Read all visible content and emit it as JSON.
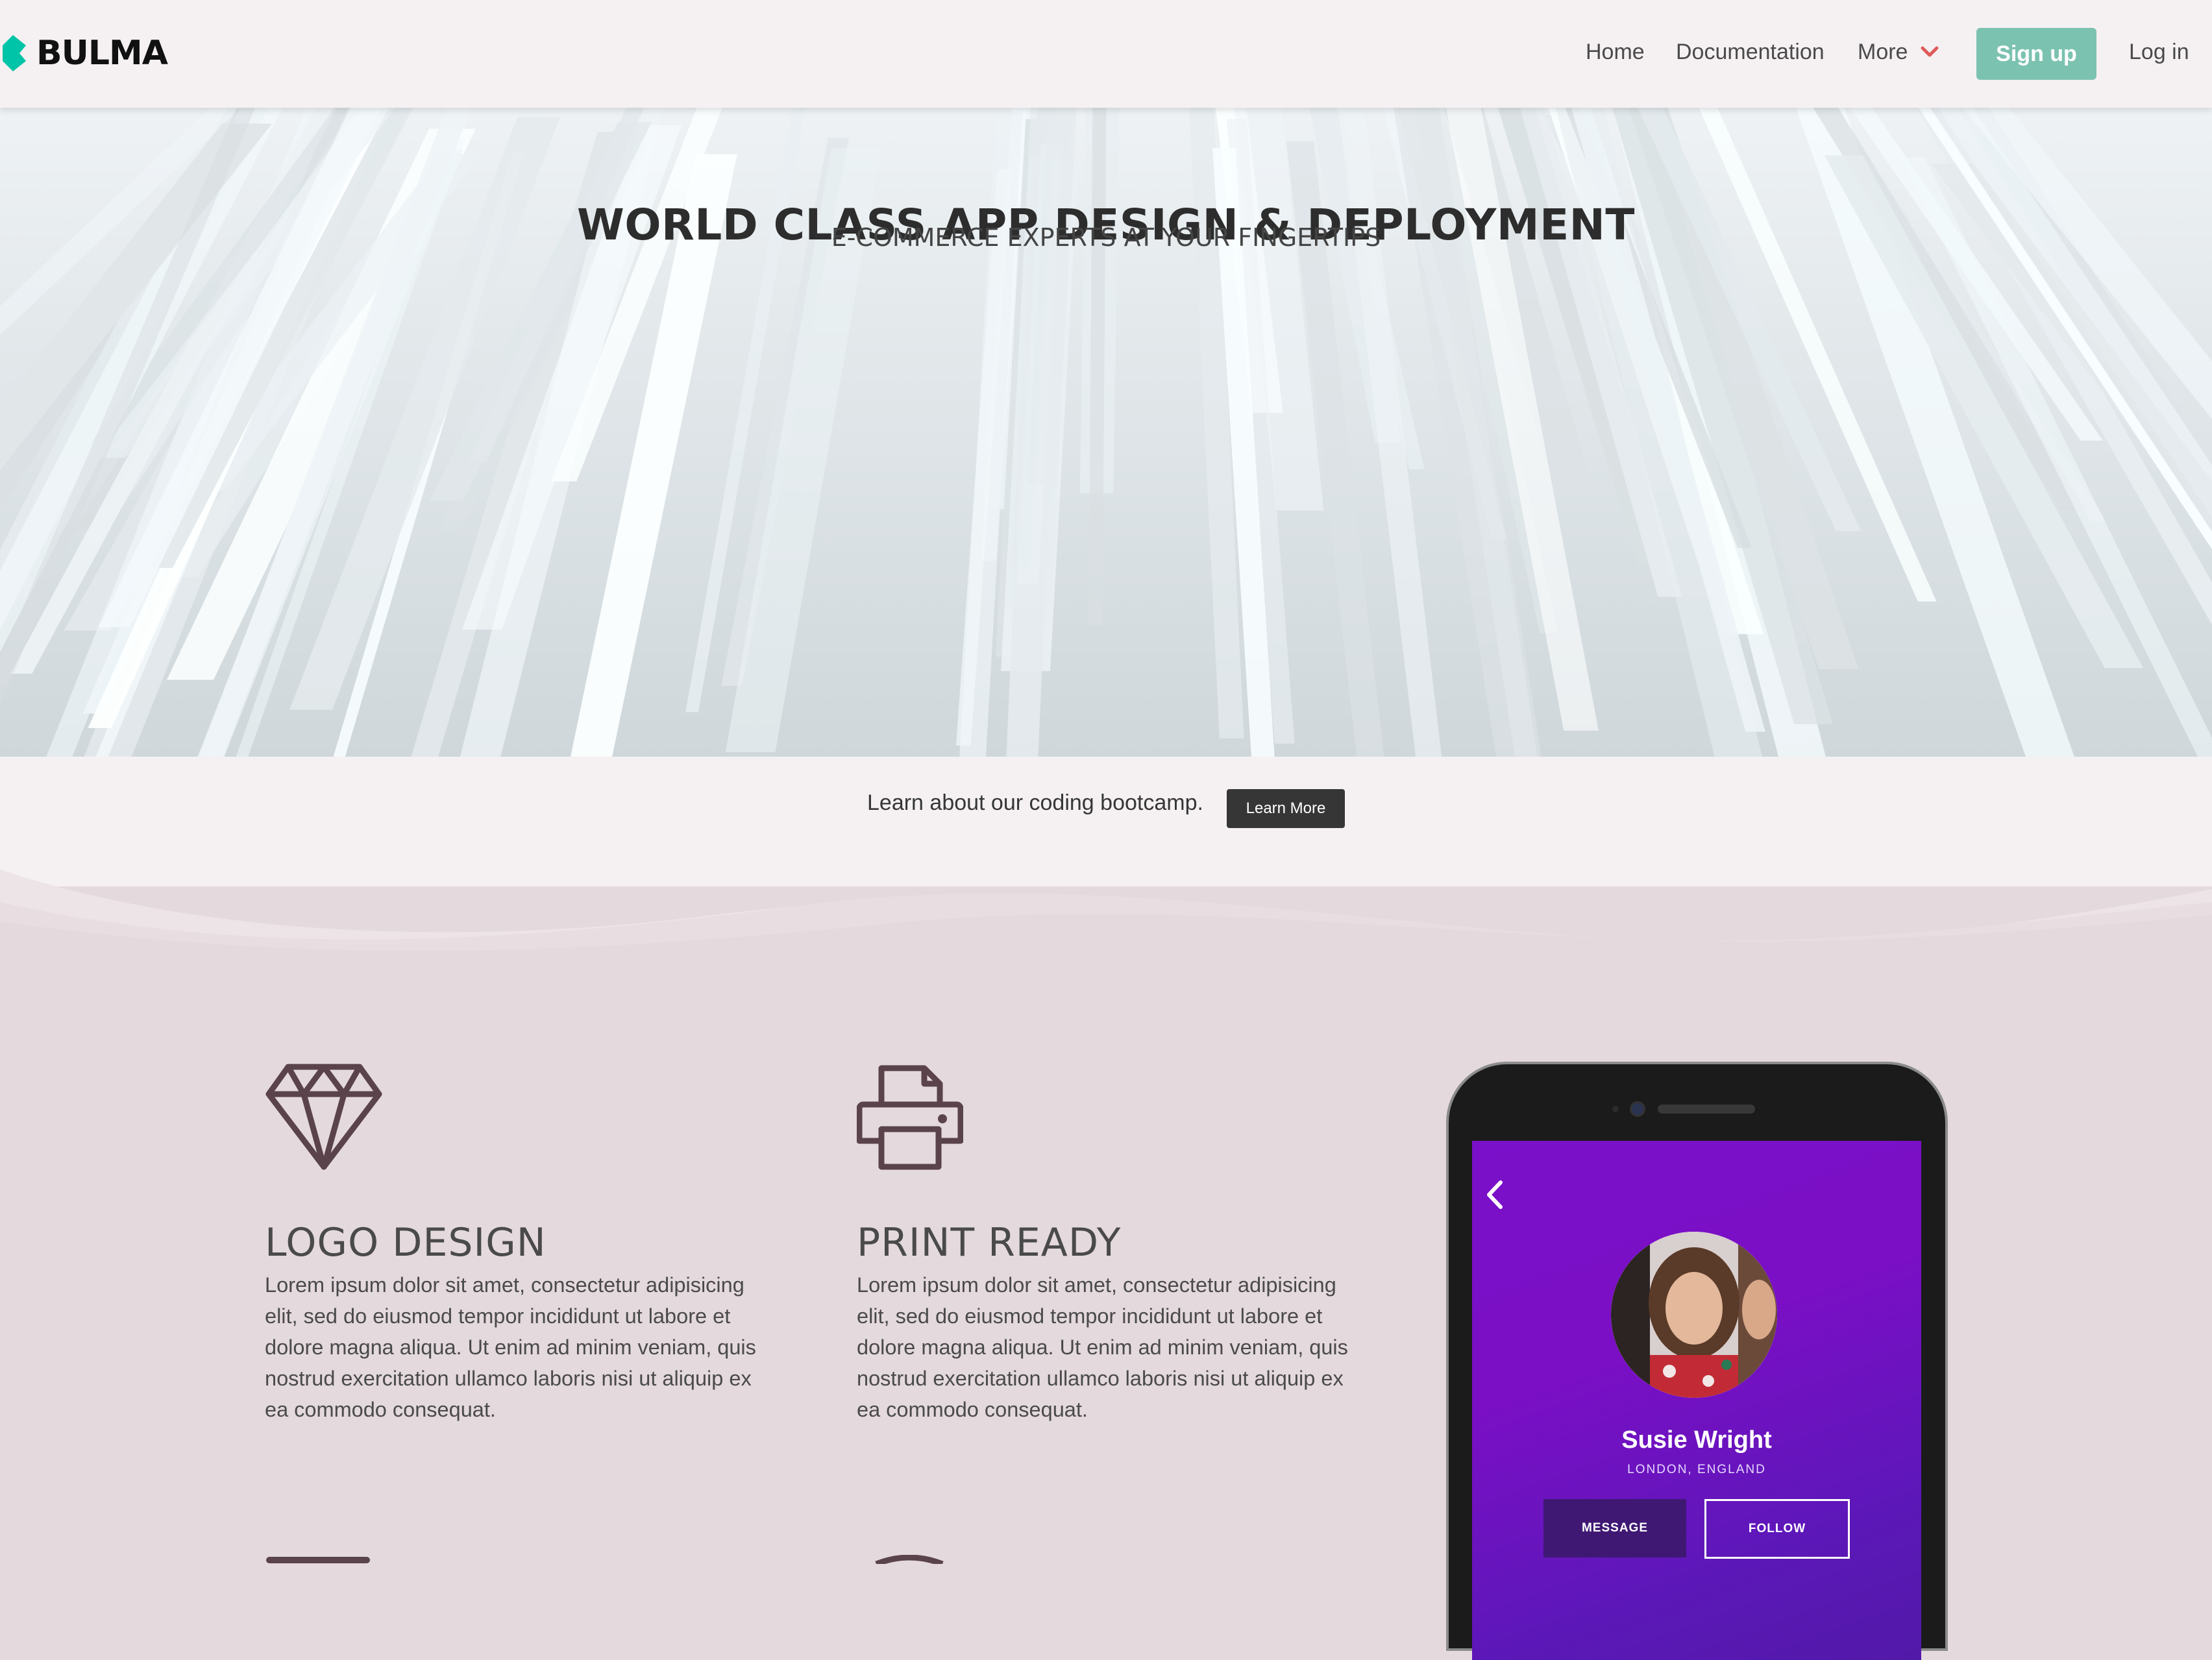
{
  "navbar": {
    "brand": "BULMA",
    "links": {
      "home": "Home",
      "documentation": "Documentation",
      "more": "More"
    },
    "signup_label": "Sign up",
    "login_label": "Log in",
    "accent_color": "#7cc2b1",
    "chevron_color": "#e05a5a"
  },
  "hero": {
    "title": "WORLD CLASS APP DESIGN & DEPLOYMENT",
    "subtitle": "E-COMMERCE EXPERTS AT YOUR FINGERTIPS"
  },
  "cta": {
    "text": "Learn about our coding bootcamp.",
    "button_label": "Learn More"
  },
  "features": [
    {
      "icon": "diamond-icon",
      "title": "LOGO DESIGN",
      "description": "Lorem ipsum dolor sit amet, consectetur adipisicing elit, sed do eiusmod tempor incididunt ut labore et dolore magna aliqua. Ut enim ad minim veniam, quis nostrud exercitation ullamco laboris nisi ut aliquip ex ea commodo consequat."
    },
    {
      "icon": "printer-icon",
      "title": "PRINT READY",
      "description": "Lorem ipsum dolor sit amet, consectetur adipisicing elit, sed do eiusmod tempor incididunt ut labore et dolore magna aliqua. Ut enim ad minim veniam, quis nostrud exercitation ullamco laboris nisi ut aliquip ex ea commodo consequat."
    }
  ],
  "phone_profile": {
    "name": "Susie Wright",
    "location": "LONDON, ENGLAND",
    "message_label": "MESSAGE",
    "follow_label": "FOLLOW"
  },
  "colors": {
    "page_bg": "#e4d9dc",
    "nav_bg": "#f5f1f2",
    "icon_stroke": "#5a434b",
    "profile_gradient": "#7a10c9"
  }
}
